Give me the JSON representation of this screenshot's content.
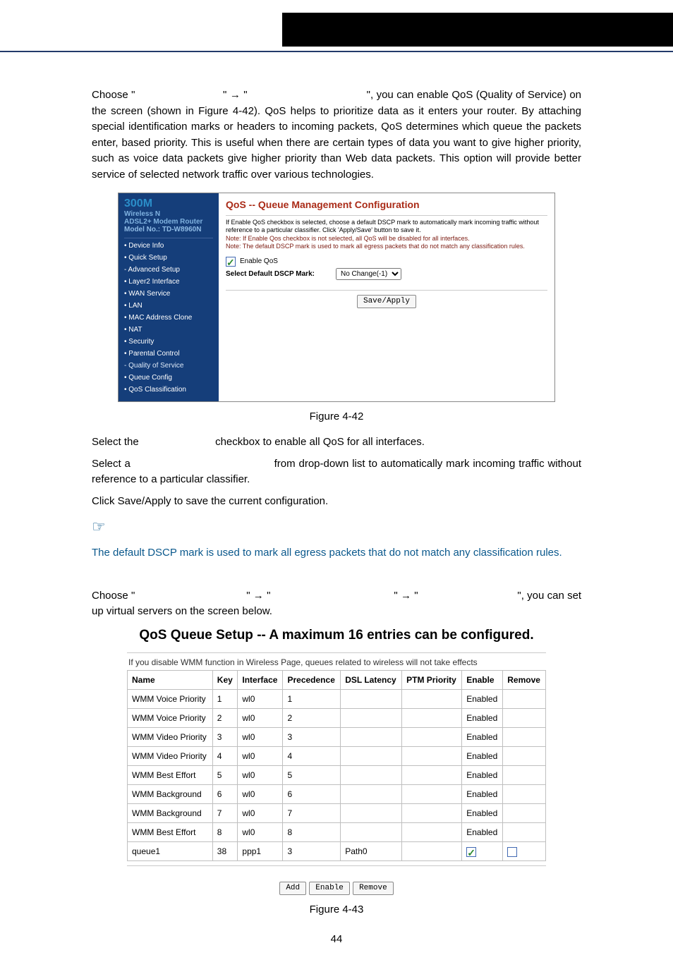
{
  "sections": {
    "qos_intro_pre": "Choose \"",
    "qos_intro_mid1": "\"",
    "arrow": "→",
    "qos_intro_mid2": "\"",
    "qos_intro_post": "\", you can enable QoS (Quality of Service) on the screen (shown in Figure 4-42). QoS helps to prioritize data as it enters your router. By attaching special identification marks or headers to incoming packets, QoS determines which queue the packets enter, based priority. This is useful when there are certain types of data you want to give higher priority, such as voice data packets give higher priority than Web data packets. This option will provide better service of selected network traffic over various technologies."
  },
  "fig42": {
    "brand_big": "300M",
    "brand_l1": "Wireless N",
    "brand_l2": "ADSL2+ Modem Router",
    "brand_l3": "Model No.: TD-W8960N",
    "menu": [
      "• Device Info",
      "• Quick Setup",
      "- Advanced Setup",
      "  • Layer2 Interface",
      "  • WAN Service",
      "  • LAN",
      "  • MAC Address Clone",
      "  • NAT",
      "  • Security",
      "  • Parental Control",
      "  - Quality of Service",
      "    • Queue Config",
      "    • QoS Classification"
    ],
    "title": "QoS -- Queue Management Configuration",
    "note_first": "If Enable QoS checkbox is selected, choose a default DSCP mark to automatically mark incoming traffic without reference to a particular classifier. Click 'Apply/Save' button to save it.",
    "note1": "Note: If Enable Qos checkbox is not selected, all QoS will be disabled for all interfaces.",
    "note2": "Note: The default DSCP mark is used to mark all egress packets that do not match any classification rules.",
    "enable_label": "Enable QoS",
    "dscp_label": "Select Default DSCP Mark:",
    "dscp_option": "No Change(-1)",
    "apply_btn": "Save/Apply",
    "caption": "Figure 4-42"
  },
  "body2": {
    "l1a": "Select the ",
    "l1b": " checkbox to enable all QoS for all interfaces.",
    "l2a": "Select a ",
    "l2b": " from drop-down list to automatically mark incoming traffic without reference to a particular classifier.",
    "l3": "Click Save/Apply to save the current configuration.",
    "note": "The default DSCP mark is used to mark all egress packets that do not match any classification rules."
  },
  "queue_intro": {
    "choose": "Choose \"",
    "blank": "",
    "sep": "\"",
    "tail": "\", you can set up virtual servers on the screen below."
  },
  "fig43": {
    "title": "QoS Queue Setup -- A maximum 16 entries can be configured.",
    "note": "If you disable WMM function in Wireless Page, queues related to wireless will not take effects",
    "headers": [
      "Name",
      "Key",
      "Interface",
      "Precedence",
      "DSL Latency",
      "PTM Priority",
      "Enable",
      "Remove"
    ],
    "rows": [
      {
        "name": "WMM Voice Priority",
        "key": "1",
        "iface": "wl0",
        "prec": "1",
        "dsl": "",
        "ptm": "",
        "enable": "Enabled",
        "remove": ""
      },
      {
        "name": "WMM Voice Priority",
        "key": "2",
        "iface": "wl0",
        "prec": "2",
        "dsl": "",
        "ptm": "",
        "enable": "Enabled",
        "remove": ""
      },
      {
        "name": "WMM Video Priority",
        "key": "3",
        "iface": "wl0",
        "prec": "3",
        "dsl": "",
        "ptm": "",
        "enable": "Enabled",
        "remove": ""
      },
      {
        "name": "WMM Video Priority",
        "key": "4",
        "iface": "wl0",
        "prec": "4",
        "dsl": "",
        "ptm": "",
        "enable": "Enabled",
        "remove": ""
      },
      {
        "name": "WMM Best Effort",
        "key": "5",
        "iface": "wl0",
        "prec": "5",
        "dsl": "",
        "ptm": "",
        "enable": "Enabled",
        "remove": ""
      },
      {
        "name": "WMM Background",
        "key": "6",
        "iface": "wl0",
        "prec": "6",
        "dsl": "",
        "ptm": "",
        "enable": "Enabled",
        "remove": ""
      },
      {
        "name": "WMM Background",
        "key": "7",
        "iface": "wl0",
        "prec": "7",
        "dsl": "",
        "ptm": "",
        "enable": "Enabled",
        "remove": ""
      },
      {
        "name": "WMM Best Effort",
        "key": "8",
        "iface": "wl0",
        "prec": "8",
        "dsl": "",
        "ptm": "",
        "enable": "Enabled",
        "remove": ""
      },
      {
        "name": "queue1",
        "key": "38",
        "iface": "ppp1",
        "prec": "3",
        "dsl": "Path0",
        "ptm": "",
        "enable": "cb-checked",
        "remove": "cb"
      }
    ],
    "btns": {
      "add": "Add",
      "enable": "Enable",
      "remove": "Remove"
    },
    "caption": "Figure 4-43"
  },
  "page_no": "44"
}
